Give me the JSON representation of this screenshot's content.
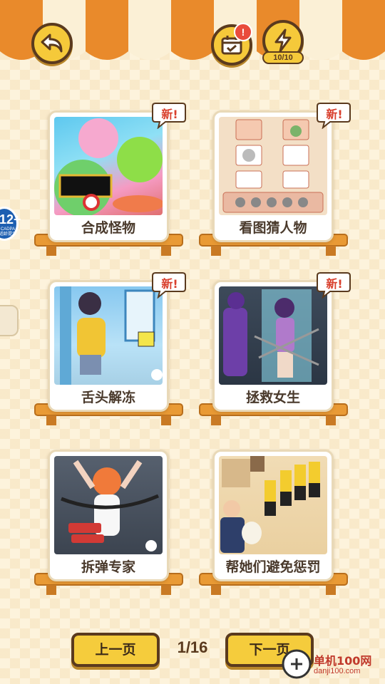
{
  "header": {
    "energy_count": "10/10",
    "calendar_alert": "!",
    "icons": [
      "back-arrow-icon",
      "calendar-icon",
      "lightning-icon"
    ]
  },
  "side": {
    "age_rating": "12+",
    "age_rating_sub": "CADPA 适龄提示"
  },
  "games": [
    {
      "title": "合成怪物",
      "is_new": true,
      "new_label": "新!"
    },
    {
      "title": "看图猜人物",
      "is_new": true,
      "new_label": "新!"
    },
    {
      "title": "舌头解冻",
      "is_new": true,
      "new_label": "新!"
    },
    {
      "title": "拯救女生",
      "is_new": true,
      "new_label": "新!"
    },
    {
      "title": "拆弹专家",
      "is_new": false
    },
    {
      "title": "帮她们避免惩罚",
      "is_new": false
    }
  ],
  "pagination": {
    "prev_label": "上一页",
    "next_label": "下一页",
    "page": "1/16"
  },
  "watermark": {
    "name": "单机100网",
    "url": "danji100.com"
  },
  "colors": {
    "accent_yellow": "#f5cc3c",
    "outline_brown": "#5a3a1e",
    "awning_orange": "#e98a2b",
    "new_badge_red": "#d9402e"
  }
}
